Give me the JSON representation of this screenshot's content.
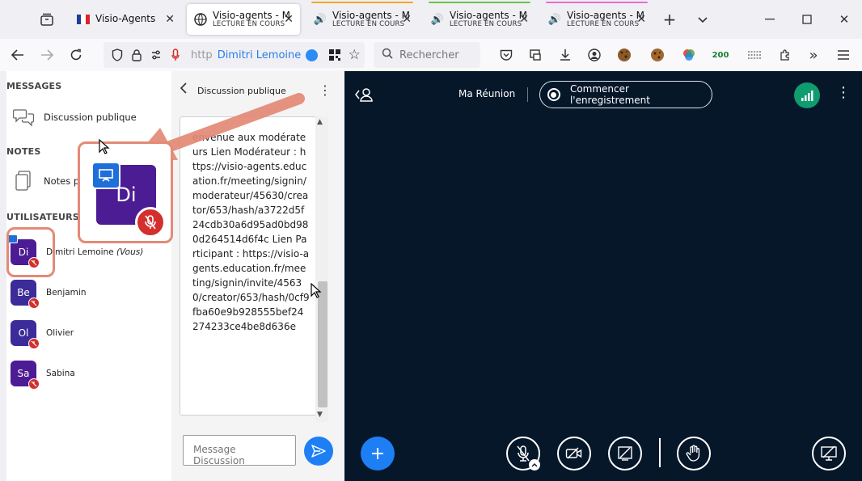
{
  "browser": {
    "tabs": [
      {
        "title": "Visio-Agents",
        "subtitle": "",
        "active": false
      },
      {
        "title": "Visio-agents - M",
        "subtitle": "LECTURE EN COURS",
        "active": true
      },
      {
        "title": "Visio-agents - M",
        "subtitle": "LECTURE EN COURS",
        "active": false
      },
      {
        "title": "Visio-agents - M",
        "subtitle": "LECTURE EN COURS",
        "active": false
      },
      {
        "title": "Visio-agents - M",
        "subtitle": "LECTURE EN COURS",
        "active": false
      }
    ],
    "url_protocol": "http",
    "url_identity": "Dimitri Lemoine",
    "search_placeholder": "Rechercher",
    "toolbar_badge": "200",
    "colors": {
      "accent_blue": "#1e7ff5",
      "tab_line_orange": "#f5a623",
      "tab_line_green": "#6cc24a",
      "tab_line_pink": "#e86bd0"
    }
  },
  "sidebar": {
    "messages_title": "MESSAGES",
    "public_chat": "Discussion publique",
    "notes_title": "NOTES",
    "shared_notes": "Notes pa",
    "users_title": "UTILISATEURS (4)",
    "users": [
      {
        "initials": "Di",
        "name": "Dimitri Lemoine",
        "you_label": "(Vous)",
        "presenter": true
      },
      {
        "initials": "Be",
        "name": "Benjamin",
        "you_label": "",
        "presenter": false
      },
      {
        "initials": "Ol",
        "name": "Olivier",
        "you_label": "",
        "presenter": false
      },
      {
        "initials": "Sa",
        "name": "Sabina",
        "you_label": "",
        "presenter": false
      }
    ],
    "zoom_initials": "Di"
  },
  "chat": {
    "title": "Discussion publique",
    "message": "envenue aux modérateurs Lien Modérateur : https://visio-agents.education.fr/meeting/signin/moderateur/45630/creator/653/hash/a3722d5f24cdb30a6d95ad0bd980d264514d6f4c Lien Participant : https://visio-agents.education.fr/meeting/signin/invite/45630/creator/653/hash/0cf9fba60e9b928555bef24274233ce4be8d636e",
    "input_placeholder": "Message Discussion"
  },
  "meeting": {
    "title": "Ma Réunion",
    "record_label": "Commencer l'enregistrement",
    "colors": {
      "background": "#06172a",
      "signal": "#0f9d6f"
    }
  }
}
